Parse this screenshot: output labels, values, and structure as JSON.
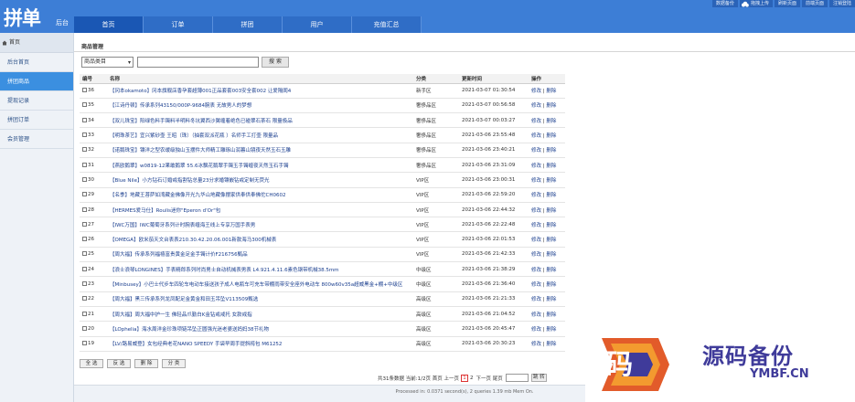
{
  "logo": {
    "big": "拼单",
    "small": "后台"
  },
  "nav": {
    "tabs": [
      {
        "label": "首页",
        "active": true
      },
      {
        "label": "订单",
        "active": false
      },
      {
        "label": "拼团",
        "active": false
      },
      {
        "label": "用户",
        "active": false
      },
      {
        "label": "充值汇总",
        "active": false
      }
    ]
  },
  "topbar": {
    "buttons": [
      "数据备份",
      "拖拽上传",
      "刷新页面",
      "前端页面",
      "注销登陆"
    ]
  },
  "sidebar": {
    "head": "首页",
    "items": [
      {
        "label": "后台首页",
        "active": false
      },
      {
        "label": "拼团商品",
        "active": true
      },
      {
        "label": "提现记录",
        "active": false
      },
      {
        "label": "拼团订单",
        "active": false
      },
      {
        "label": "会员管理",
        "active": false
      }
    ]
  },
  "page": {
    "title": "商品管理"
  },
  "search": {
    "select_value": "商品类目",
    "input_value": "",
    "button_label": "搜 索"
  },
  "table": {
    "headers": [
      "编号",
      "名称",
      "分类",
      "更新时间",
      "操作"
    ],
    "op_edit": "修改",
    "op_sep": " | ",
    "op_delete": "删除",
    "rows": [
      {
        "id": "36",
        "name": "【冈本okamoto】冈本旗舰店香孕套超薄001正品套套003安全套002 让爱隔阂4",
        "cat": "新手区",
        "time": "2021-03-07 01:30:54"
      },
      {
        "id": "35",
        "name": "【江诗丹顿】传承系列43150/000P-9684腕表 无故男人的梦想",
        "cat": "奢侈品区",
        "time": "2021-03-07 00:56:58"
      },
      {
        "id": "34",
        "name": "【双儿珠宝】阳绿色料手镯料半明料冬坑翼西沙翼缠着绝色已碰翠石茶石 限量极品",
        "cat": "奢侈品区",
        "time": "2021-03-07 00:03:27"
      },
      {
        "id": "33",
        "name": "【明珠茶艺】宜兴紫砂壶 王昭（珠）（抽套双派花瓶 ）名师手工打壶 限量品",
        "cat": "奢侈品区",
        "time": "2021-03-06 23:55:48"
      },
      {
        "id": "32",
        "name": "【诺鹅珠宝】镶洋之型农缓级独山玉摆件大师精工雕琢山润暮山镜夜天然玉石玉雕",
        "cat": "奢侈品区",
        "time": "2021-03-06 23:40:21"
      },
      {
        "id": "31",
        "name": "【燕欧鹅翠】w0819-12果敢鹅翠 55.6冰飘花鹅翠手镯玉手镯缠夜天然玉石手镯",
        "cat": "奢侈品区",
        "time": "2021-03-06 23:31:09"
      },
      {
        "id": "30",
        "name": "【Blue Nile】小方钻石订婚戒指割钻总量23分求婚镶嵌钻戒定制无荧光",
        "cat": "VIP区",
        "time": "2021-03-06 23:00:31"
      },
      {
        "id": "29",
        "name": "【名季】地藏王菩萨如湾藏金佛像开光九华山地藏像摆家供奉供奉佛佗CH0602",
        "cat": "VIP区",
        "time": "2021-03-06 22:59:20"
      },
      {
        "id": "28",
        "name": "【HERMES爱马仕】Roulis迷你\"Eperon d'Or\"包",
        "cat": "VIP区",
        "time": "2021-03-06 22:44:32"
      },
      {
        "id": "27",
        "name": "【IWC万国】IWC葡萄牙系列计时腕表缠海王线上专享万国手表男",
        "cat": "VIP区",
        "time": "2021-03-06 22:22:48"
      },
      {
        "id": "26",
        "name": "【OMEGA】欧米茄天文台表表210.30.42.20.06.001新款海马300机械表",
        "cat": "VIP区",
        "time": "2021-03-06 22:01:53"
      },
      {
        "id": "25",
        "name": "【周大福】传承系列福禧富贵黄金足金手镯计价F216756甄品",
        "cat": "VIP区",
        "time": "2021-03-06 21:42:33"
      },
      {
        "id": "24",
        "name": "【浪士浪琴LONGINES】手表精郎系列时尚男士自动机械表男表 L4.921.4.11.6素色钢带机械38.5mm",
        "cat": "中级区",
        "time": "2021-03-06 21:38:29"
      },
      {
        "id": "23",
        "name": "【Minbusey】小巴士代步车四轮车电动车接送孩子成人电瓶车可充车带棚雨带安全座外电动车 800w60v35a超威黑金+棚+中级区",
        "cat": "中级区",
        "time": "2021-03-06 21:36:40"
      },
      {
        "id": "22",
        "name": "【周大福】黑三传承系列龙凤配足金黄金和田玉吊坠V113509甄选",
        "cat": "高级区",
        "time": "2021-03-06 21:21:33"
      },
      {
        "id": "21",
        "name": "【周大福】周大福中护一生 佛轻品爪勤白K金钻戒戒托 女款戒指",
        "cat": "高级区",
        "time": "2021-03-06 21:04:52"
      },
      {
        "id": "20",
        "name": "【LOphelia】海水周洋金珍珠项链吊坠正圆强光迷老婆送妈妈38节礼物",
        "cat": "高级区",
        "time": "2021-03-06 20:45:47"
      },
      {
        "id": "19",
        "name": "【LV/路易威登】女包经典老花NANO SPEEDY 手袋早周手提斜挎包 M61252",
        "cat": "高级区",
        "time": "2021-03-06 20:30:23"
      }
    ]
  },
  "bulk": {
    "buttons": [
      "全 选",
      "反 选",
      "删 除",
      "分 类"
    ]
  },
  "pager": {
    "summary": "共31条数据 当前:1/2页 首页 上一页",
    "current": "1",
    "next_page": "2",
    "tail": "下一页 尾页",
    "go_label": "跳 转"
  },
  "footer": {
    "text": "Processed in: 0.0371 second(s), 2 queries 1.39 mb Mem On."
  },
  "watermark": {
    "char": "码",
    "title": "源码备份",
    "domain": "YMBF.CN"
  },
  "colors": {
    "header_blue": "#3d7ed6",
    "sidebar_active": "#3b8fe0",
    "link": "#1b3f8f"
  }
}
